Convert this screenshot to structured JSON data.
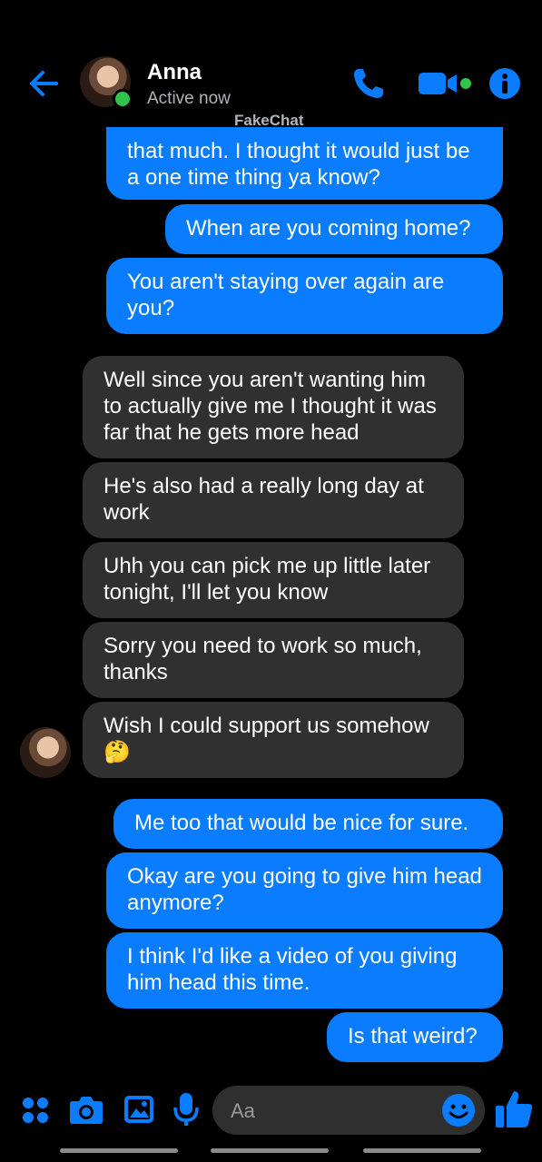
{
  "header": {
    "contact_name": "Anna",
    "status": "Active now",
    "watermark": "FakeChat",
    "accent_color": "#0a7cff",
    "online_color": "#31c34a",
    "icons": [
      "back-arrow-icon",
      "phone-icon",
      "video-camera-icon",
      "info-icon"
    ]
  },
  "messages": [
    {
      "dir": "out",
      "text": "that much. I thought it would just be a one time thing ya know?"
    },
    {
      "dir": "out",
      "text": "When are you coming home?"
    },
    {
      "dir": "out",
      "text": "You aren't staying over again are you?"
    },
    {
      "dir": "in",
      "text": "Well since you aren't wanting him to actually give me I thought it was far that he gets more head"
    },
    {
      "dir": "in",
      "text": "He's also had a really long day at work"
    },
    {
      "dir": "in",
      "text": "Uhh you can pick me up little later tonight, I'll let you know"
    },
    {
      "dir": "in",
      "text": "Sorry you need to work so much, thanks"
    },
    {
      "dir": "in",
      "text": "Wish I could support us somehow 🤔"
    },
    {
      "dir": "out",
      "text": "Me too that would be nice for sure."
    },
    {
      "dir": "out",
      "text": "Okay are you going to give him head anymore?"
    },
    {
      "dir": "out",
      "text": "I think I'd like a video of you giving him head this time."
    },
    {
      "dir": "out",
      "text": "Is that weird?"
    }
  ],
  "composer": {
    "placeholder": "Aa",
    "icons": [
      "menu-dots-icon",
      "camera-icon",
      "gallery-icon",
      "microphone-icon",
      "emoji-icon",
      "thumbs-up-icon"
    ]
  }
}
